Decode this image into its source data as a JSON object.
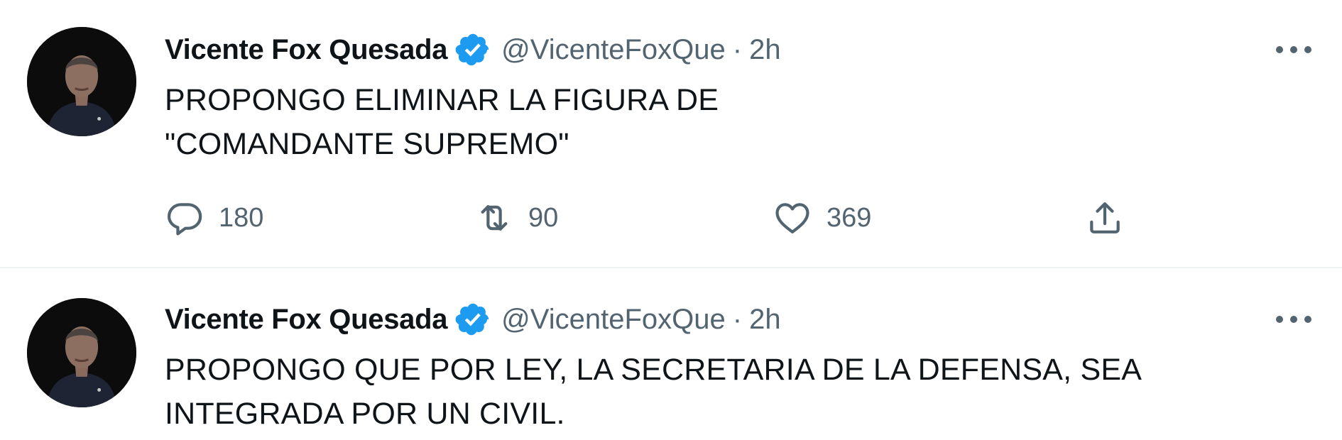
{
  "tweets": [
    {
      "display_name": "Vicente Fox Quesada",
      "handle": "@VicenteFoxQue",
      "separator": "·",
      "time": "2h",
      "text_lines": [
        "PROPONGO ELIMINAR LA FIGURA DE",
        "\"COMANDANTE SUPREMO\""
      ],
      "replies": "180",
      "retweets": "90",
      "likes": "369"
    },
    {
      "display_name": "Vicente Fox Quesada",
      "handle": "@VicenteFoxQue",
      "separator": "·",
      "time": "2h",
      "text_lines": [
        "PROPONGO QUE POR LEY, LA SECRETARIA DE LA DEFENSA, SEA",
        "INTEGRADA POR UN CIVIL."
      ]
    }
  ],
  "icons": {
    "verified": "verified-badge-icon",
    "more": "more-options-icon",
    "reply": "reply-icon",
    "retweet": "retweet-icon",
    "like": "like-icon",
    "share": "share-icon"
  },
  "colors": {
    "text": "#0f1419",
    "secondary": "#536471",
    "verified": "#1d9bf0",
    "divider": "#eff3f4"
  }
}
